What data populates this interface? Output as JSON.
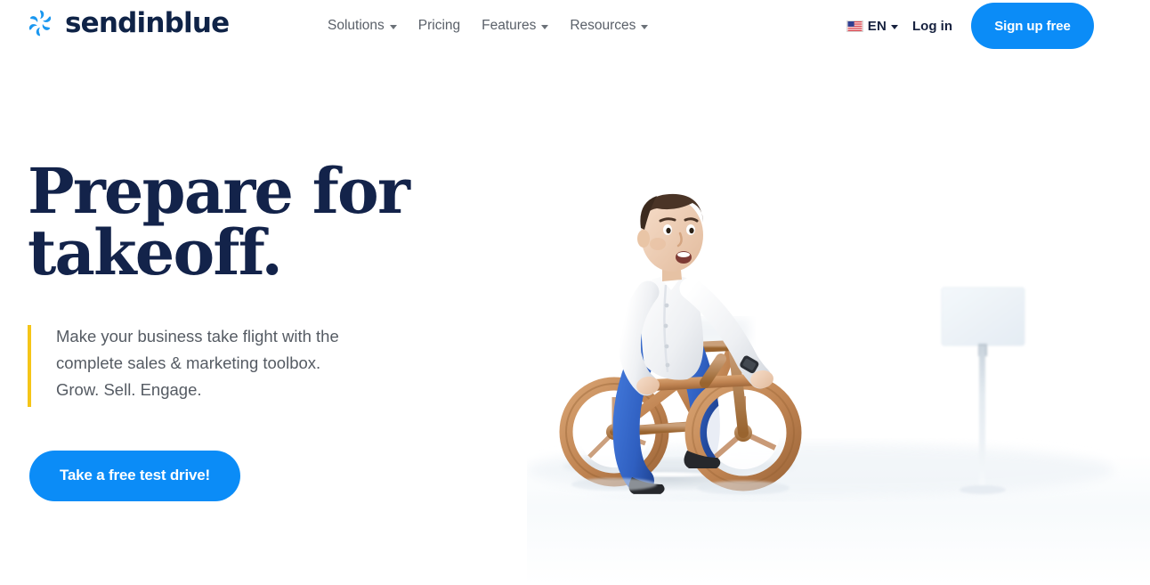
{
  "brand": {
    "name": "sendinblue",
    "logo_icon": "pinwheel-flower-icon",
    "logo_color": "#1a97f0",
    "wordmark_color": "#0f2347"
  },
  "header": {
    "nav": [
      {
        "label": "Solutions",
        "has_dropdown": true
      },
      {
        "label": "Pricing",
        "has_dropdown": false
      },
      {
        "label": "Features",
        "has_dropdown": true
      },
      {
        "label": "Resources",
        "has_dropdown": true
      }
    ],
    "language": {
      "code": "EN",
      "flag_icon": "us-flag-icon",
      "has_dropdown": true
    },
    "login_label": "Log in",
    "signup_label": "Sign up free",
    "signup_color": "#0b8cf7"
  },
  "hero": {
    "title": "Prepare for\ntakeoff.",
    "title_color": "#13234a",
    "subtitle": "Make your business take flight with the\ncomplete sales & marketing toolbox.\nGrow. Sell. Engage.",
    "subtitle_color": "#555b63",
    "accent_bar_color": "#f5c518",
    "cta_label": "Take a free test drive!",
    "cta_color": "#0b8cf7",
    "illustration": {
      "description": "3D rendered character riding a wooden bicycle on a white floor with a blank white signpost in the background",
      "character_shirt_color": "#f2f3f5",
      "character_pants_color": "#2f62c4",
      "character_hair_color": "#4a3426",
      "bicycle_wood_color": "#c08a5c",
      "signpost_color": "#eef3f7"
    }
  }
}
